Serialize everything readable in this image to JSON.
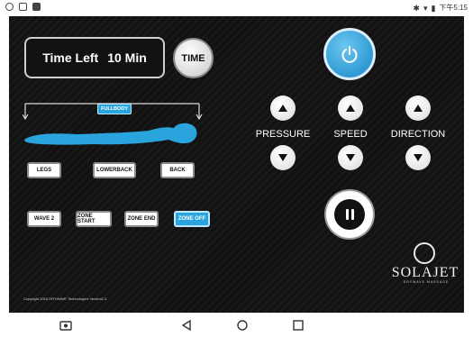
{
  "status_bar": {
    "left_icons": [
      "settings-icon",
      "notification-icon",
      "image-icon"
    ],
    "right_icons": [
      "bluetooth-icon",
      "wifi-icon",
      "battery-icon"
    ],
    "clock": "下午5:15"
  },
  "timer": {
    "label": "Time Left",
    "value": "10 Min",
    "button_label": "TIME"
  },
  "body_map": {
    "fullbody_label": "FULLBODY",
    "zones": [
      {
        "label": "LEGS"
      },
      {
        "label": "LOWERBACK"
      },
      {
        "label": "BACK"
      }
    ],
    "modes": [
      {
        "label": "WAVE 2"
      },
      {
        "label": "ZONE START"
      },
      {
        "label": "ZONE END"
      },
      {
        "label": "ZONE OFF",
        "active": true
      }
    ]
  },
  "controls": {
    "pressure_label": "PRESSURE",
    "speed_label": "SPEED",
    "direction_label": "DIRECTION"
  },
  "logo": {
    "brand": "SOLAJET",
    "tagline": "DRYWAVE MASSAGE"
  },
  "copyright": "Copyright 2016 DRYWAVE Technologies Version1.3",
  "colors": {
    "accent": "#2aa4dc",
    "power": "#3aa6dc",
    "background": "#121212"
  },
  "nav_bar": {
    "items": [
      "screenshot-icon",
      "back-icon",
      "home-icon",
      "recents-icon"
    ]
  }
}
